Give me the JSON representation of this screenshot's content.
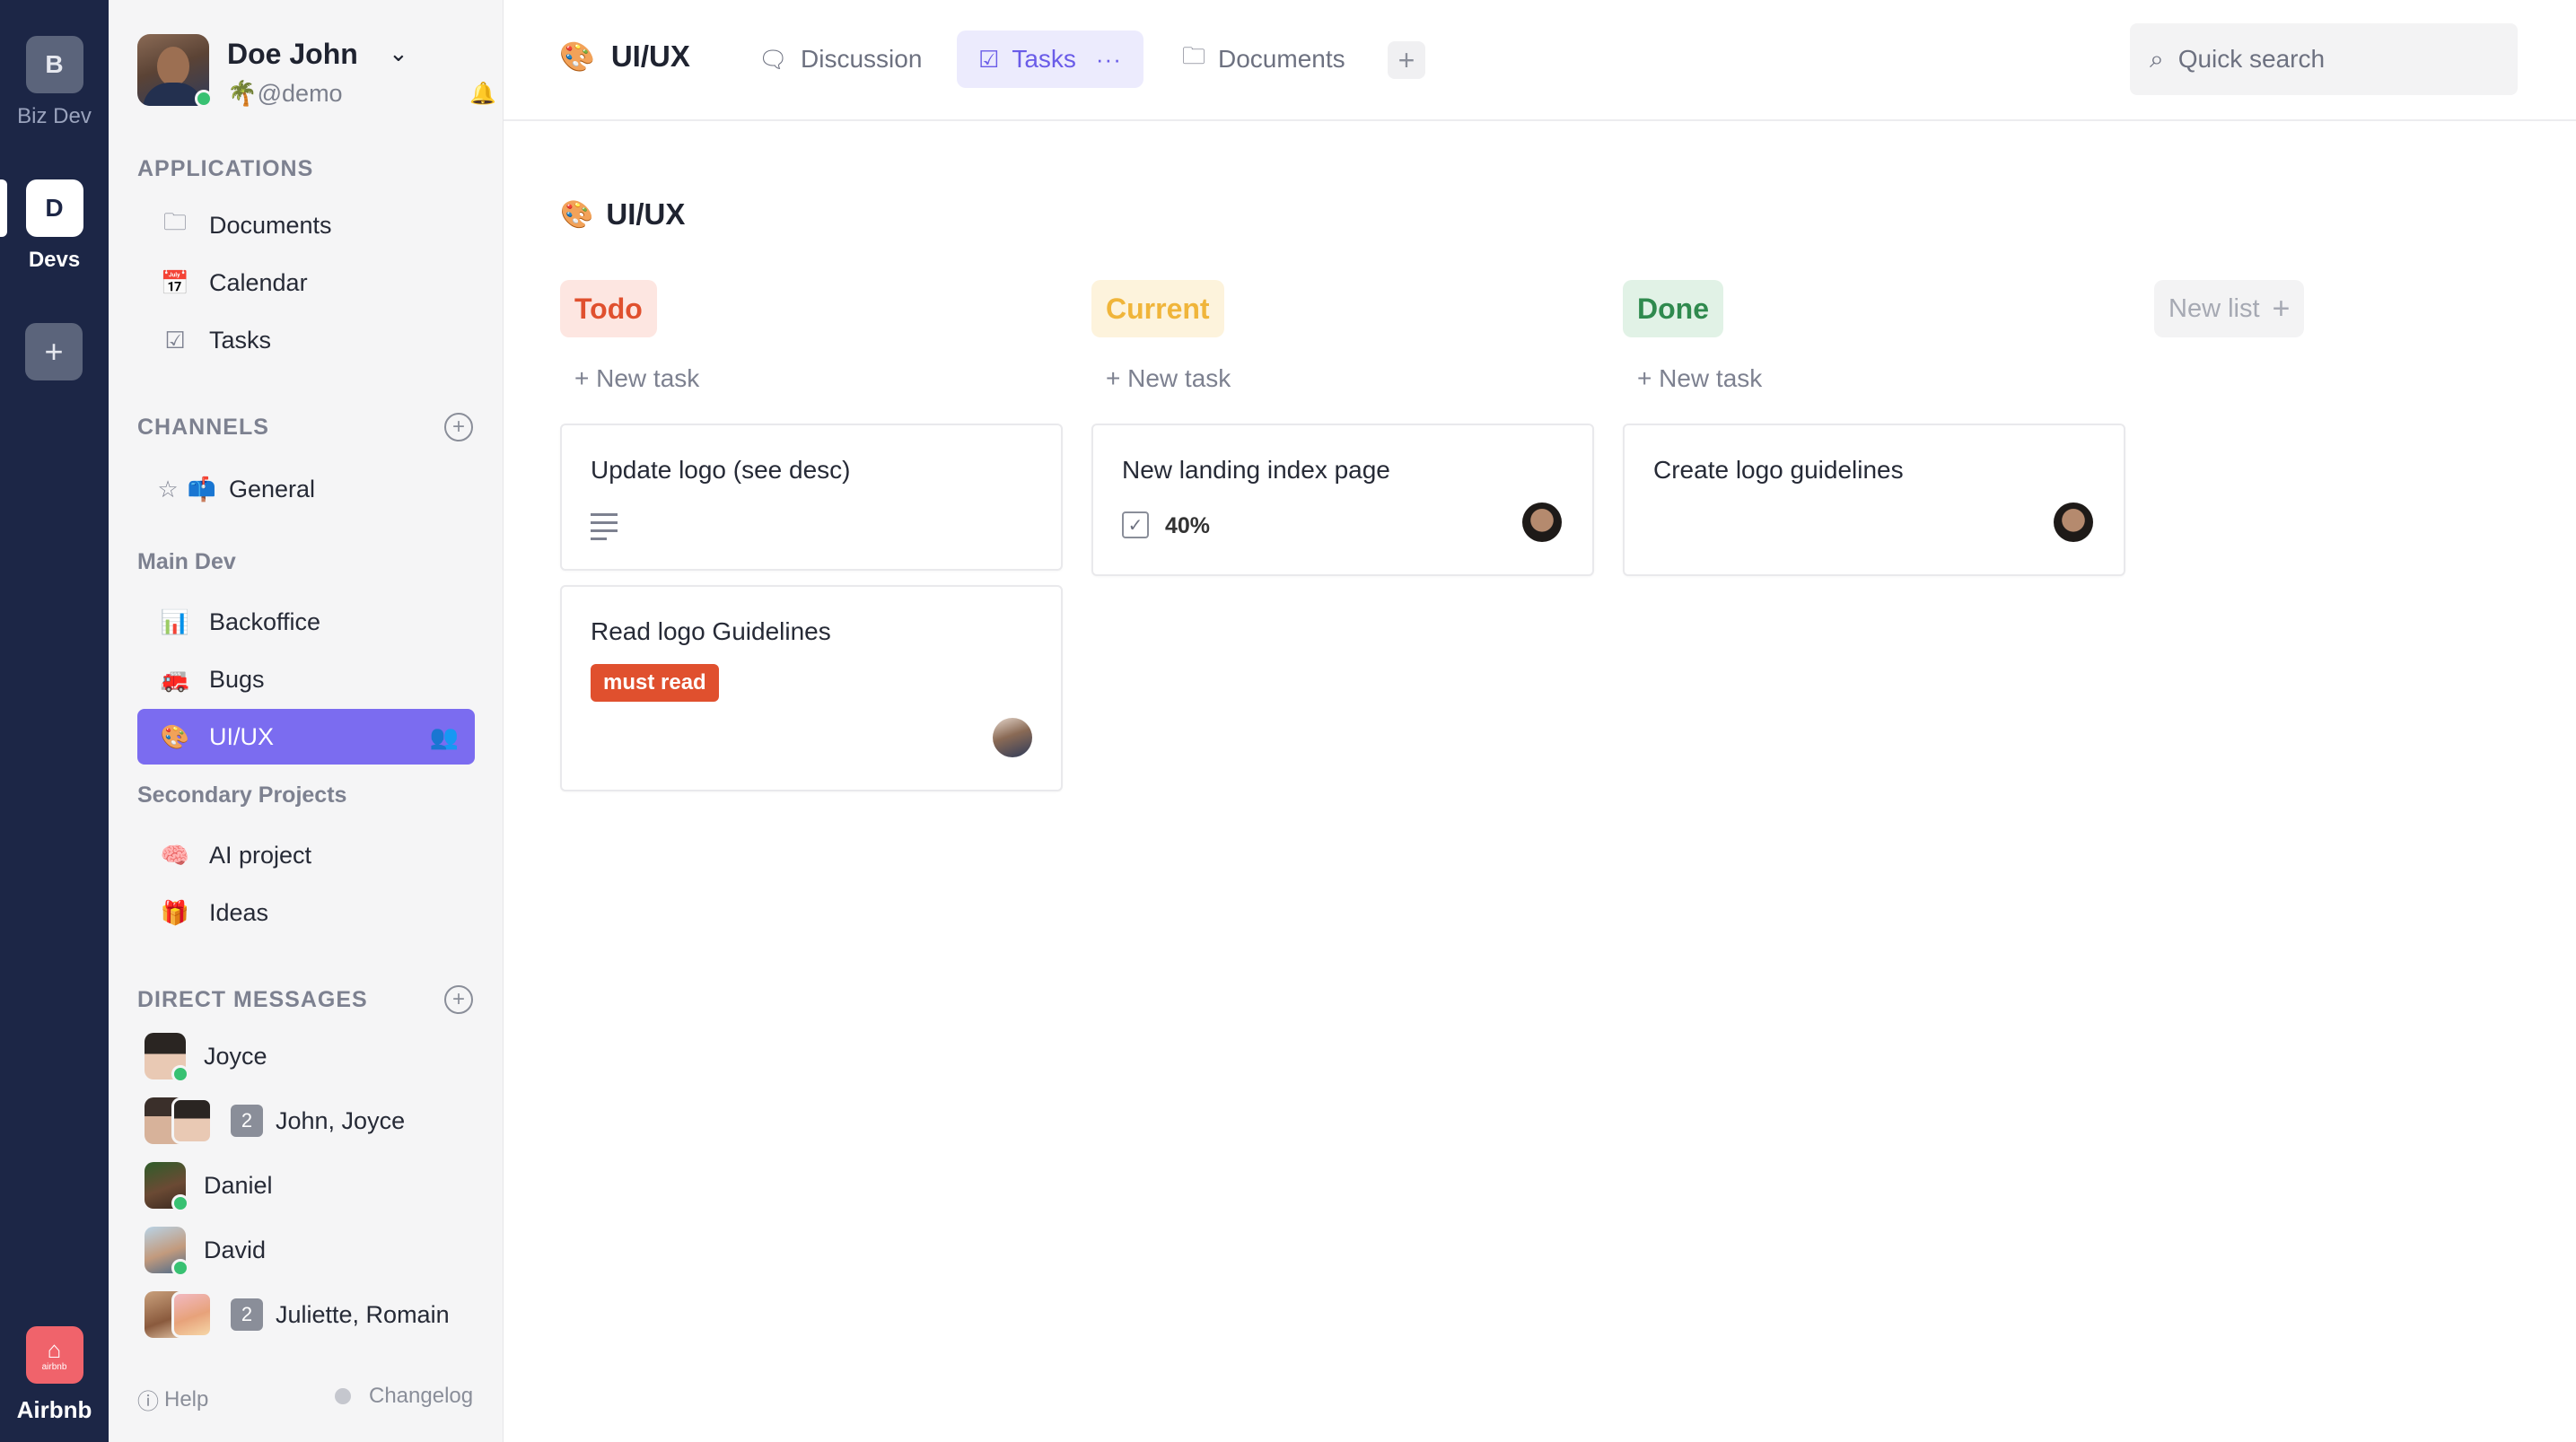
{
  "workspaces": [
    {
      "initial": "B",
      "label": "Biz Dev",
      "active": false
    },
    {
      "initial": "D",
      "label": "Devs",
      "active": true
    }
  ],
  "brand": {
    "mark": "⌂",
    "small": "airbnb",
    "label": "Airbnb",
    "color": "#f0636b"
  },
  "profile": {
    "name": "Doe John",
    "handle": "@demo"
  },
  "applications": {
    "heading": "APPLICATIONS",
    "items": [
      "Documents",
      "Calendar",
      "Tasks"
    ]
  },
  "channels": {
    "heading": "CHANNELS",
    "items": [
      "General"
    ]
  },
  "groups": [
    {
      "heading": "Main Dev",
      "items": [
        "Backoffice",
        "Bugs",
        "UI/UX"
      ]
    },
    {
      "heading": "Secondary Projects",
      "items": [
        "AI project",
        "Ideas"
      ]
    }
  ],
  "direct_messages": {
    "heading": "DIRECT MESSAGES",
    "items": [
      {
        "name": "Joyce"
      },
      {
        "name": "John, Joyce",
        "count": "2"
      },
      {
        "name": "Daniel"
      },
      {
        "name": "David"
      },
      {
        "name": "Juliette, Romain",
        "count": "2"
      }
    ]
  },
  "footer": {
    "help": "Help",
    "changelog": "Changelog"
  },
  "topbar": {
    "title": "UI/UX",
    "tabs": [
      "Discussion",
      "Tasks",
      "Documents"
    ],
    "active_tab": "Tasks",
    "search_placeholder": "Quick search"
  },
  "board": {
    "title": "UI/UX",
    "new_task_label": "+ New task",
    "new_list_label": "New list",
    "columns": [
      {
        "label": "Todo",
        "color": "#e0502e",
        "bg": "#fde6e1",
        "cards": [
          {
            "title": "Update logo (see desc)",
            "has_description": true
          },
          {
            "title": "Read logo Guidelines",
            "tag": "must read"
          }
        ]
      },
      {
        "label": "Current",
        "color": "#f0b53a",
        "bg": "#fdf3dc",
        "cards": [
          {
            "title": "New landing index page",
            "progress": "40%"
          }
        ]
      },
      {
        "label": "Done",
        "color": "#2f8a4e",
        "bg": "#e1f2e6",
        "cards": [
          {
            "title": "Create logo guidelines"
          }
        ]
      }
    ]
  },
  "colors": {
    "accent": "#7b6cf0",
    "rail": "#1c2646",
    "online": "#38c172"
  }
}
